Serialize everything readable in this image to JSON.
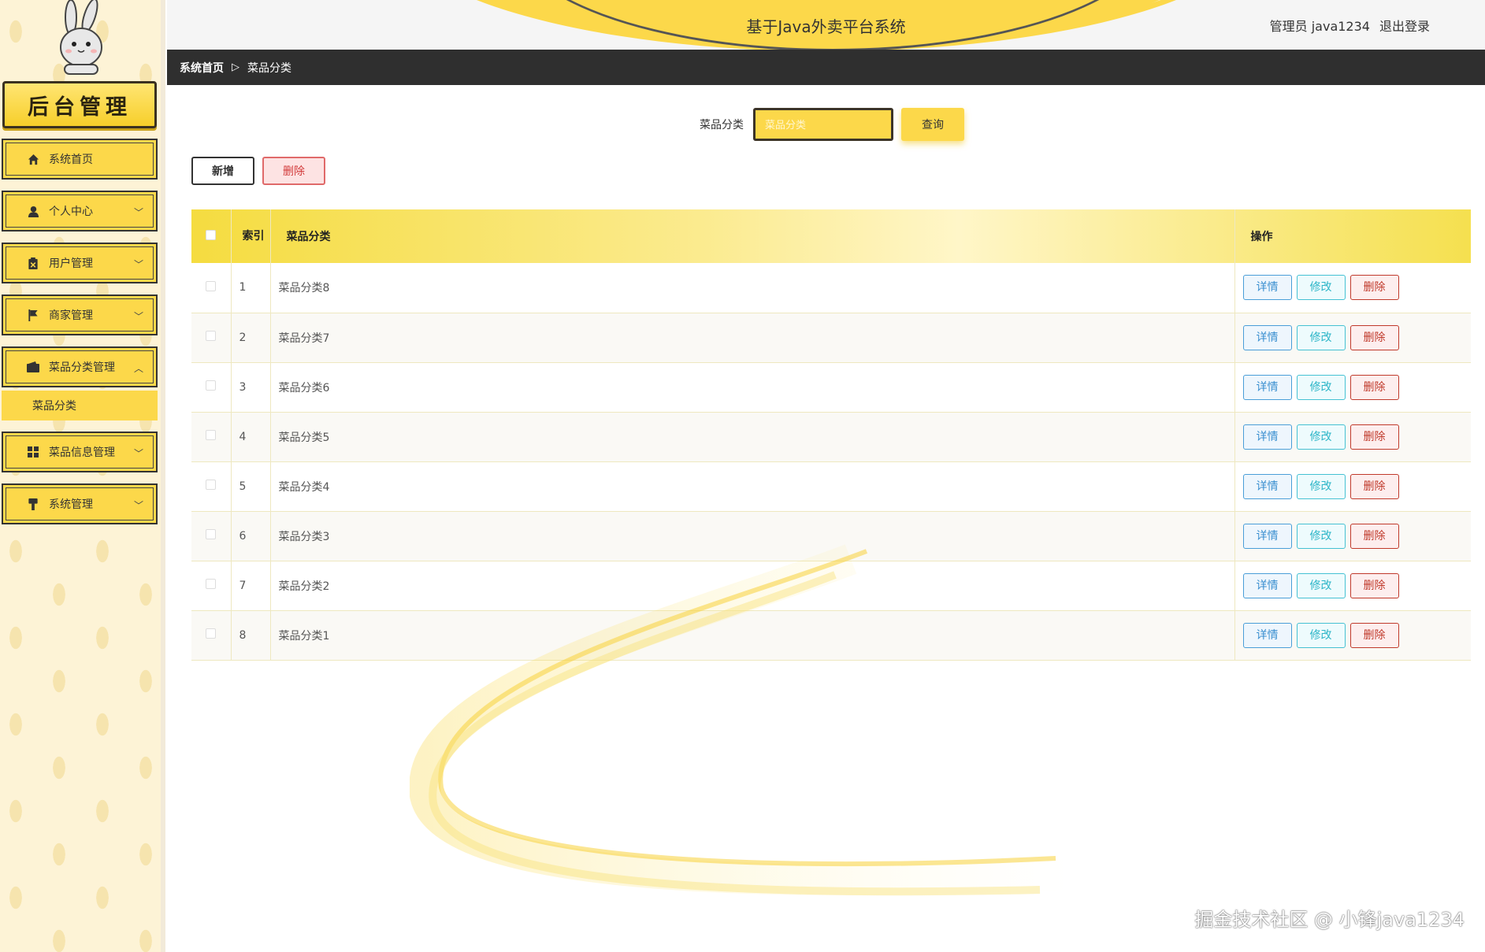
{
  "sidebar": {
    "logo_text": "后台管理",
    "items": [
      {
        "label": "系统首页",
        "icon": "home-icon",
        "expandable": false
      },
      {
        "label": "个人中心",
        "icon": "user-icon",
        "expandable": true
      },
      {
        "label": "用户管理",
        "icon": "clipboard-icon",
        "expandable": true
      },
      {
        "label": "商家管理",
        "icon": "flag-icon",
        "expandable": true
      },
      {
        "label": "菜品分类管理",
        "icon": "wallet-icon",
        "expandable": true,
        "expanded": true,
        "children": [
          "菜品分类"
        ]
      },
      {
        "label": "菜品信息管理",
        "icon": "grid-icon",
        "expandable": true
      },
      {
        "label": "系统管理",
        "icon": "brush-icon",
        "expandable": true
      }
    ]
  },
  "header": {
    "title": "基于Java外卖平台系统",
    "user_label": "管理员 java1234",
    "logout_label": "退出登录"
  },
  "breadcrumb": {
    "home": "系统首页",
    "separator": "▷",
    "current": "菜品分类"
  },
  "search": {
    "label": "菜品分类",
    "placeholder": "菜品分类",
    "value": "",
    "button": "查询"
  },
  "actions": {
    "add": "新增",
    "delete": "删除"
  },
  "table": {
    "columns": {
      "index": "索引",
      "name": "菜品分类",
      "ops": "操作"
    },
    "op_labels": {
      "detail": "详情",
      "edit": "修改",
      "delete": "删除"
    },
    "rows": [
      {
        "index": "1",
        "name": "菜品分类8"
      },
      {
        "index": "2",
        "name": "菜品分类7"
      },
      {
        "index": "3",
        "name": "菜品分类6"
      },
      {
        "index": "4",
        "name": "菜品分类5"
      },
      {
        "index": "5",
        "name": "菜品分类4"
      },
      {
        "index": "6",
        "name": "菜品分类3"
      },
      {
        "index": "7",
        "name": "菜品分类2"
      },
      {
        "index": "8",
        "name": "菜品分类1"
      }
    ]
  },
  "watermark": "掘金技术社区 @ 小锋java1234",
  "colors": {
    "accent": "#fcd84a",
    "dark_bar": "#2f2f2f",
    "detail": "#3a8fd0",
    "edit": "#2cb5c8",
    "delete": "#c0392b"
  }
}
